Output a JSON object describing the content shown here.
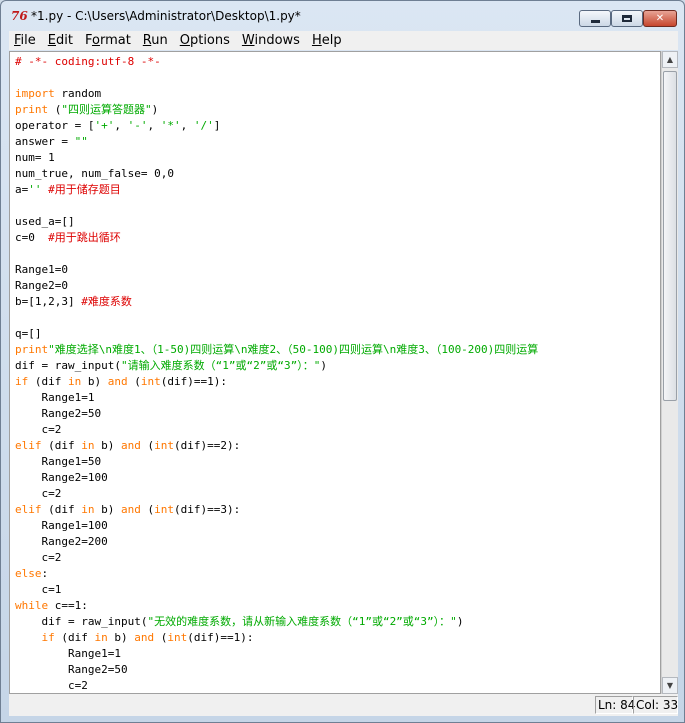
{
  "window": {
    "title": "*1.py - C:\\Users\\Administrator\\Desktop\\1.py*",
    "icon": "idle-python-icon",
    "controls": {
      "minimize": "minimize-icon",
      "maximize": "maximize-icon",
      "close": "✕"
    }
  },
  "menu": {
    "items": [
      {
        "key": "F",
        "rest": "ile"
      },
      {
        "key": "E",
        "rest": "dit"
      },
      {
        "pre": "F",
        "key": "o",
        "rest": "rmat"
      },
      {
        "key": "R",
        "rest": "un"
      },
      {
        "key": "O",
        "rest": "ptions"
      },
      {
        "key": "W",
        "rest": "indows"
      },
      {
        "key": "H",
        "rest": "elp"
      }
    ]
  },
  "editor": {
    "lines": [
      [
        [
          "comment",
          "# -*- coding:utf-8 -*-"
        ]
      ],
      [],
      [
        [
          "keyword",
          "import"
        ],
        [
          "plain",
          " random"
        ]
      ],
      [
        [
          "keyword",
          "print"
        ],
        [
          "plain",
          " ("
        ],
        [
          "string",
          "\"四则运算答题器\""
        ],
        [
          "plain",
          ")"
        ]
      ],
      [
        [
          "plain",
          "operator = ["
        ],
        [
          "string",
          "'+'"
        ],
        [
          "plain",
          ", "
        ],
        [
          "string",
          "'-'"
        ],
        [
          "plain",
          ", "
        ],
        [
          "string",
          "'*'"
        ],
        [
          "plain",
          ", "
        ],
        [
          "string",
          "'/'"
        ],
        [
          "plain",
          "]"
        ]
      ],
      [
        [
          "plain",
          "answer = "
        ],
        [
          "string",
          "\"\""
        ]
      ],
      [
        [
          "plain",
          "num= 1"
        ]
      ],
      [
        [
          "plain",
          "num_true, num_false= 0,0"
        ]
      ],
      [
        [
          "plain",
          "a="
        ],
        [
          "string",
          "''"
        ],
        [
          "plain",
          " "
        ],
        [
          "comment",
          "#用于储存题目"
        ]
      ],
      [],
      [
        [
          "plain",
          "used_a=[]"
        ]
      ],
      [
        [
          "plain",
          "c=0  "
        ],
        [
          "comment",
          "#用于跳出循环"
        ]
      ],
      [],
      [
        [
          "plain",
          "Range1=0"
        ]
      ],
      [
        [
          "plain",
          "Range2=0"
        ]
      ],
      [
        [
          "plain",
          "b=[1,2,3] "
        ],
        [
          "comment",
          "#难度系数"
        ]
      ],
      [],
      [
        [
          "plain",
          "q=[]"
        ]
      ],
      [
        [
          "keyword",
          "print"
        ],
        [
          "string",
          "\"难度选择\\n难度1、（1-50)四则运算\\n难度2、（50-100)四则运算\\n难度3、（100-200)四则运算"
        ]
      ],
      [
        [
          "plain",
          "dif = raw_input("
        ],
        [
          "string",
          "\"请输入难度系数（“1”或“2”或“3”）：\""
        ],
        [
          "plain",
          ")"
        ]
      ],
      [
        [
          "keyword",
          "if"
        ],
        [
          "plain",
          " (dif "
        ],
        [
          "keyword",
          "in"
        ],
        [
          "plain",
          " b) "
        ],
        [
          "keyword",
          "and"
        ],
        [
          "plain",
          " ("
        ],
        [
          "keyword",
          "int"
        ],
        [
          "plain",
          "(dif)==1):"
        ]
      ],
      [
        [
          "plain",
          "    Range1=1"
        ]
      ],
      [
        [
          "plain",
          "    Range2=50"
        ]
      ],
      [
        [
          "plain",
          "    c=2"
        ]
      ],
      [
        [
          "keyword",
          "elif"
        ],
        [
          "plain",
          " (dif "
        ],
        [
          "keyword",
          "in"
        ],
        [
          "plain",
          " b) "
        ],
        [
          "keyword",
          "and"
        ],
        [
          "plain",
          " ("
        ],
        [
          "keyword",
          "int"
        ],
        [
          "plain",
          "(dif)==2):"
        ]
      ],
      [
        [
          "plain",
          "    Range1=50"
        ]
      ],
      [
        [
          "plain",
          "    Range2=100"
        ]
      ],
      [
        [
          "plain",
          "    c=2"
        ]
      ],
      [
        [
          "keyword",
          "elif"
        ],
        [
          "plain",
          " (dif "
        ],
        [
          "keyword",
          "in"
        ],
        [
          "plain",
          " b) "
        ],
        [
          "keyword",
          "and"
        ],
        [
          "plain",
          " ("
        ],
        [
          "keyword",
          "int"
        ],
        [
          "plain",
          "(dif)==3):"
        ]
      ],
      [
        [
          "plain",
          "    Range1=100"
        ]
      ],
      [
        [
          "plain",
          "    Range2=200"
        ]
      ],
      [
        [
          "plain",
          "    c=2"
        ]
      ],
      [
        [
          "keyword",
          "else"
        ],
        [
          "plain",
          ":"
        ]
      ],
      [
        [
          "plain",
          "    c=1"
        ]
      ],
      [
        [
          "keyword",
          "while"
        ],
        [
          "plain",
          " c==1:"
        ]
      ],
      [
        [
          "plain",
          "    dif = raw_input("
        ],
        [
          "string",
          "\"无效的难度系数，请从新输入难度系数（“1”或“2”或“3”）：\""
        ],
        [
          "plain",
          ")"
        ]
      ],
      [
        [
          "plain",
          "    "
        ],
        [
          "keyword",
          "if"
        ],
        [
          "plain",
          " (dif "
        ],
        [
          "keyword",
          "in"
        ],
        [
          "plain",
          " b) "
        ],
        [
          "keyword",
          "and"
        ],
        [
          "plain",
          " ("
        ],
        [
          "keyword",
          "int"
        ],
        [
          "plain",
          "(dif)==1):"
        ]
      ],
      [
        [
          "plain",
          "        Range1=1"
        ]
      ],
      [
        [
          "plain",
          "        Range2=50"
        ]
      ],
      [
        [
          "plain",
          "        c=2"
        ]
      ]
    ],
    "colors": {
      "comment": "#dd0000",
      "keyword": "#ff7700",
      "string": "#00aa00",
      "plain": "#000000"
    }
  },
  "status": {
    "line": "Ln: 84",
    "column": "Col: 33"
  }
}
